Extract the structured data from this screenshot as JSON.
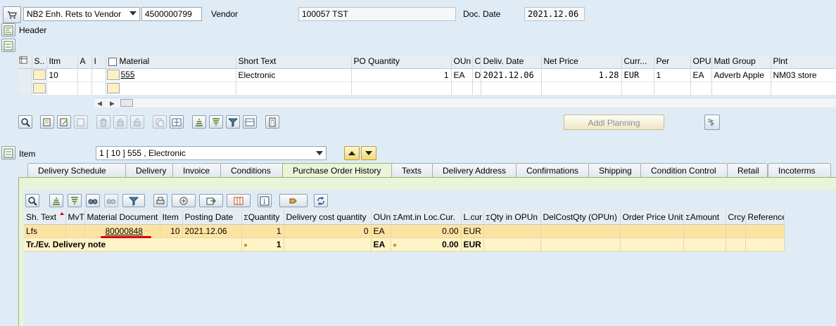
{
  "header_bar": {
    "doc_type": "NB2 Enh. Rets to Vendor",
    "po_number": "4500000799",
    "vendor_label": "Vendor",
    "vendor_value": "100057 TST",
    "doc_date_label": "Doc. Date",
    "doc_date_value": "2021.12.06"
  },
  "header_section_label": "Header",
  "items_table": {
    "columns": [
      "S..",
      "Itm",
      "A",
      "I",
      "Material",
      "Short Text",
      "PO Quantity",
      "OUn",
      "C",
      "Deliv. Date",
      "Net Price",
      "Curr...",
      "Per",
      "OPU",
      "Matl Group",
      "Plnt"
    ],
    "row": {
      "itm": "10",
      "material": "555",
      "short_text": "Electronic",
      "po_quantity": "1",
      "oun": "EA",
      "c": "D",
      "deliv_date": "2021.12.06",
      "net_price": "1.28",
      "curr": "EUR",
      "per": "1",
      "opu": "EA",
      "matl_group": "Adverb Apple",
      "plnt": "NM03 store"
    }
  },
  "addl_planning_button": "Addl Planning",
  "item_section": {
    "label": "Item",
    "selected": "1 [ 10 ] 555 , Electronic"
  },
  "tabs": [
    {
      "label": "Delivery Schedule",
      "active": false
    },
    {
      "label": "Delivery",
      "active": false
    },
    {
      "label": "Invoice",
      "active": false
    },
    {
      "label": "Conditions",
      "active": false
    },
    {
      "label": "Purchase Order History",
      "active": true
    },
    {
      "label": "Texts",
      "active": false
    },
    {
      "label": "Delivery Address",
      "active": false
    },
    {
      "label": "Confirmations",
      "active": false
    },
    {
      "label": "Shipping",
      "active": false
    },
    {
      "label": "Condition Control",
      "active": false
    },
    {
      "label": "Retail",
      "active": false
    },
    {
      "label": "Incoterms",
      "active": false
    }
  ],
  "history_table": {
    "columns": [
      "Sh. Text",
      "MvT",
      "Material Document",
      "Item",
      "Posting Date",
      "Quantity",
      "Delivery cost quantity",
      "OUn",
      "Amt.in Loc.Cur.",
      "L.cur",
      "Qty in OPUn",
      "DelCostQty (OPUn)",
      "Order Price Unit",
      "Amount",
      "Crcy",
      "Reference"
    ],
    "sum_marker": "Σ",
    "row": {
      "sh_text": "Lfs",
      "mvt": "",
      "mat_doc": "80000848",
      "item": "10",
      "posting_date": "2021.12.06",
      "quantity": "1",
      "del_cost_qty": "0",
      "oun": "EA",
      "amt": "0.00",
      "lcur": "EUR"
    },
    "total": {
      "label": "Tr./Ev. Delivery note",
      "quantity": "1",
      "oun": "EA",
      "amt": "0.00",
      "lcur": "EUR"
    }
  },
  "accent_colors": {
    "selected_row": "#fde3a2",
    "active_tab": "#eaf4d8",
    "underline": "#d40000"
  }
}
